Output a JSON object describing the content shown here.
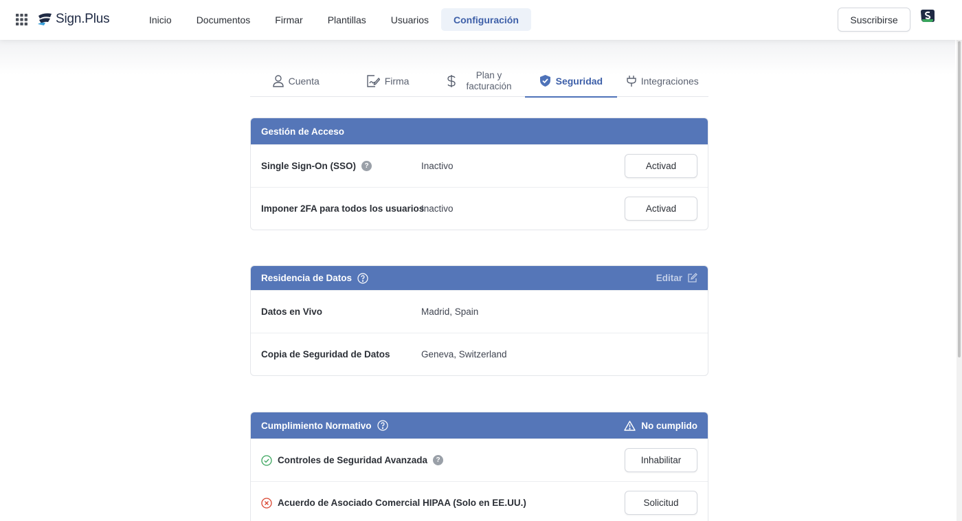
{
  "app": {
    "name": "Sign.Plus"
  },
  "nav": {
    "items": [
      {
        "label": "Inicio"
      },
      {
        "label": "Documentos"
      },
      {
        "label": "Firmar"
      },
      {
        "label": "Plantillas"
      },
      {
        "label": "Usuarios"
      },
      {
        "label": "Configuración",
        "active": true
      }
    ],
    "subscribe_label": "Suscribirse"
  },
  "settings_tabs": [
    {
      "label": "Cuenta",
      "icon": "user-icon"
    },
    {
      "label": "Firma",
      "icon": "signature-icon"
    },
    {
      "label": "Plan y facturación",
      "line1": "Plan y",
      "line2": "facturación",
      "icon": "dollar-icon"
    },
    {
      "label": "Seguridad",
      "icon": "shield-icon",
      "active": true
    },
    {
      "label": "Integraciones",
      "icon": "plug-icon"
    }
  ],
  "access_management": {
    "title": "Gestión de Acceso",
    "rows": [
      {
        "label": "Single Sign-On (SSO)",
        "value": "Inactivo",
        "button": "Activad",
        "has_help": true
      },
      {
        "label": "Imponer 2FA para todos los usuarios",
        "value": "Inactivo",
        "button": "Activad"
      }
    ]
  },
  "data_residency": {
    "title": "Residencia de Datos",
    "edit_label": "Editar",
    "rows": [
      {
        "label": "Datos en Vivo",
        "value": "Madrid, Spain"
      },
      {
        "label": "Copia de Seguridad de Datos",
        "value": "Geneva, Switzerland"
      }
    ]
  },
  "compliance": {
    "title": "Cumplimiento Normativo",
    "status": "No cumplido",
    "rows": [
      {
        "label": "Controles de Seguridad Avanzada",
        "status": "ok",
        "button": "Inhabilitar",
        "has_help": true
      },
      {
        "label": "Acuerdo de Asociado Comercial HIPAA (Solo en EE.UU.)",
        "status": "error",
        "button": "Solicitud"
      }
    ]
  },
  "colors": {
    "accent": "#5576b8",
    "active_text": "#3d5fa8",
    "success": "#3aa55d",
    "error": "#d9442f"
  }
}
